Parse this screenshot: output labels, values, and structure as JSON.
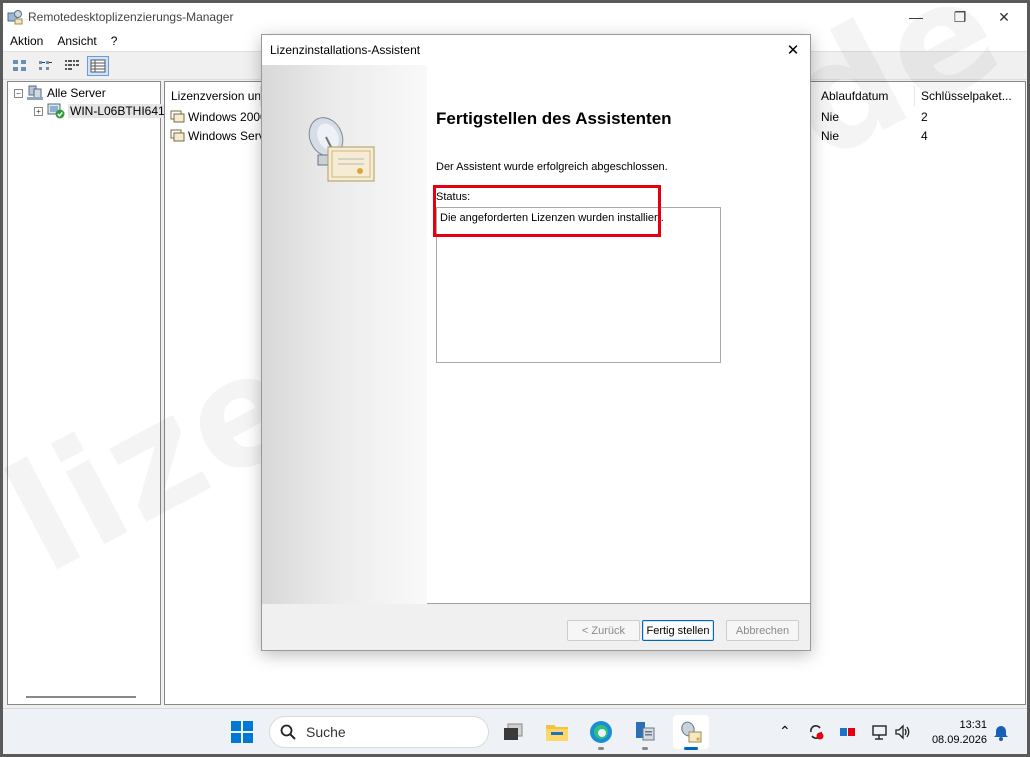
{
  "window": {
    "title": "Remotedesktoplizenzierungs-Manager",
    "controls": {
      "minimize": "—",
      "maximize": "❐",
      "close": "✕"
    }
  },
  "menu": {
    "items": [
      "Aktion",
      "Ansicht",
      "?"
    ]
  },
  "tree": {
    "root_label": "Alle Server",
    "root_expander": "−",
    "server_label": "WIN-L06BTHI641",
    "server_expander": "+"
  },
  "list": {
    "columns": [
      "Lizenzversion und -typ",
      "Ablaufdatum",
      "Schlüsselpaket..."
    ],
    "rows": [
      {
        "name": "Windows 2000",
        "expiry": "Nie",
        "pack": "2"
      },
      {
        "name": "Windows Server",
        "expiry": "Nie",
        "pack": "4"
      }
    ]
  },
  "dialog": {
    "title": "Lizenzinstallations-Assistent",
    "close": "✕",
    "heading": "Fertigstellen des Assistenten",
    "message": "Der Assistent wurde erfolgreich abgeschlossen.",
    "status_label": "Status:",
    "status_text": "Die angeforderten Lizenzen wurden installiert.",
    "buttons": {
      "back": "< Zurück",
      "finish": "Fertig stellen",
      "cancel": "Abbrechen"
    }
  },
  "watermark": "lizenzstar.de",
  "taskbar": {
    "search_placeholder": "Suche",
    "time": "13:31",
    "date": "08.09.2026"
  },
  "colors": {
    "highlight": "#e3000f",
    "accent": "#0067c0"
  }
}
